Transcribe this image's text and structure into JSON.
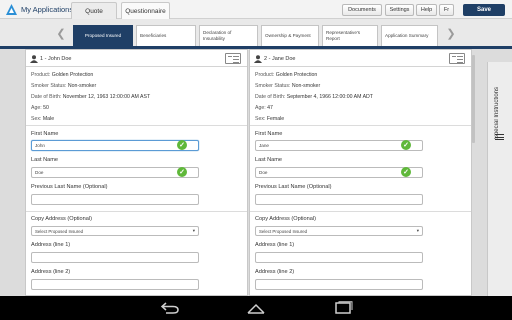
{
  "app": {
    "title": "My Applications"
  },
  "top_tabs": [
    {
      "label": "Quote"
    },
    {
      "label": "Questionnaire"
    }
  ],
  "top_buttons": {
    "documents": "Documents",
    "settings": "Settings",
    "help": "Help",
    "lang": "Fr",
    "save": "Save"
  },
  "steps": [
    {
      "label": "Proposed Insured"
    },
    {
      "label": "Beneficiaries"
    },
    {
      "label": "Declaration of Insurability"
    },
    {
      "label": "Ownership & Payment"
    },
    {
      "label": "Representative's Report"
    },
    {
      "label": "Application Summary"
    }
  ],
  "insured": [
    {
      "title": "1 - John Doe",
      "product_label": "Product:",
      "product": "Golden Protection",
      "smoker_label": "Smoker Status:",
      "smoker": "Non-smoker",
      "dob_label": "Date of Birth:",
      "dob": "November 12, 1963 12:00:00 AM AST",
      "age_label": "Age:",
      "age": "50",
      "sex_label": "Sex:",
      "sex": "Male",
      "first_name_label": "First Name",
      "first_name": "John",
      "last_name_label": "Last Name",
      "last_name": "Doe",
      "prev_last_name_label": "Previous Last Name (Optional)",
      "prev_last_name": "",
      "copy_address_label": "Copy Address (Optional)",
      "copy_address_value": "Select Proposed Insured",
      "address1_label": "Address (line 1)",
      "address1": "",
      "address2_label": "Address (line 2)",
      "address2": ""
    },
    {
      "title": "2 - Jane Doe",
      "product_label": "Product:",
      "product": "Golden Protection",
      "smoker_label": "Smoker Status:",
      "smoker": "Non-smoker",
      "dob_label": "Date of Birth:",
      "dob": "September 4, 1966 12:00:00 AM ADT",
      "age_label": "Age:",
      "age": "47",
      "sex_label": "Sex:",
      "sex": "Female",
      "first_name_label": "First Name",
      "first_name": "Jane",
      "last_name_label": "Last Name",
      "last_name": "Doe",
      "prev_last_name_label": "Previous Last Name (Optional)",
      "prev_last_name": "",
      "copy_address_label": "Copy Address (Optional)",
      "copy_address_value": "Select Proposed Insured",
      "address1_label": "Address (line 1)",
      "address1": "",
      "address2_label": "Address (line 2)",
      "address2": ""
    }
  ],
  "side_tab": {
    "label": "Special Instructions"
  },
  "colors": {
    "brand": "#1f3f66",
    "valid": "#5fb83a",
    "focus": "#5b9bd5"
  },
  "icons": {
    "back": "back-icon",
    "home": "home-icon",
    "recents": "recents-icon"
  }
}
